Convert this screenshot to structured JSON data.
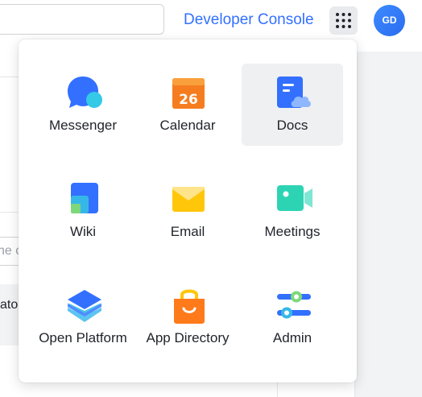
{
  "header": {
    "search_placeholder": "",
    "developer_console": "Developer Console",
    "avatar_initials": "GD"
  },
  "background": {
    "input_fragment": "he c",
    "row_fragment": "ato"
  },
  "launcher": {
    "apps": [
      {
        "label": "Messenger",
        "icon": "messenger-icon"
      },
      {
        "label": "Calendar",
        "icon": "calendar-icon",
        "date": "26"
      },
      {
        "label": "Docs",
        "icon": "docs-icon"
      },
      {
        "label": "Wiki",
        "icon": "wiki-icon"
      },
      {
        "label": "Email",
        "icon": "email-icon"
      },
      {
        "label": "Meetings",
        "icon": "meetings-icon"
      },
      {
        "label": "Open Platform",
        "icon": "open-platform-icon"
      },
      {
        "label": "App Directory",
        "icon": "app-directory-icon"
      },
      {
        "label": "Admin",
        "icon": "admin-icon"
      }
    ],
    "active_index": 2
  },
  "colors": {
    "accent": "#3370ff",
    "calendar": "#f57d1f",
    "email": "#ffc60a",
    "meetings": "#2dd4b4",
    "app_directory": "#ff7a1a"
  }
}
